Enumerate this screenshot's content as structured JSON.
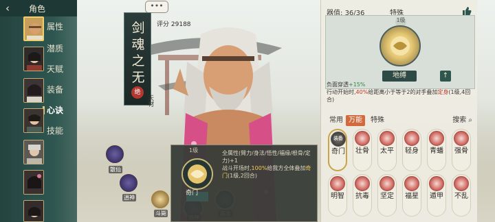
{
  "header": {
    "back_icon": "back-arrow-icon",
    "title": "角色"
  },
  "sidebar": {
    "menu": [
      {
        "label": "属性",
        "active": false
      },
      {
        "label": "潜质",
        "active": false
      },
      {
        "label": "天赋",
        "active": false
      },
      {
        "label": "装备",
        "active": false
      },
      {
        "label": "心诀",
        "active": true
      },
      {
        "label": "技能",
        "active": false
      }
    ],
    "avatars": [
      "avatar-1",
      "avatar-2",
      "avatar-3",
      "avatar-4",
      "avatar-5",
      "avatar-6",
      "avatar-7",
      "avatar-8"
    ]
  },
  "character": {
    "name": "剑魂之无",
    "name_badge": "绝",
    "talent": "天材",
    "score_label": "评分",
    "score_value": "29188",
    "chat_label": "•••"
  },
  "left_orbs": [
    {
      "label": "散仙"
    },
    {
      "label": "逍神"
    },
    {
      "label": "斗毙"
    },
    {
      "label": "游神"
    },
    {
      "label": "追击"
    }
  ],
  "popup": {
    "top_label": "1级",
    "name": "奇门",
    "text_1": "全属性(臂力/身法/悟性/福缘/根骨/定力)+1",
    "text_2_prefix": "战斗开场时,",
    "text_2_highlight": "100%",
    "text_2_mid": "给我方全体叠加",
    "text_2_buff": "奇门",
    "text_2_suffix": "(1级,2回合)"
  },
  "panel": {
    "weapon_label": "器值:",
    "weapon_value": "36/36",
    "special_label": "特殊",
    "like_icon": "thumbs-up-icon",
    "main_skill_small": "1级",
    "main_skill_name": "地缚",
    "arrow_icon": "up-arrow-icon",
    "effect_1_prefix": "负面穿透",
    "effect_1_value": "+15%",
    "effect_2_prefix": "行动开始时,",
    "effect_2_pct": "40%",
    "effect_2_mid": "给距离小于等于2的对手叠加",
    "effect_2_buff": "定身",
    "effect_2_suffix": "(1级,4回合)"
  },
  "tabs": [
    {
      "label": "常用",
      "active": false
    },
    {
      "label": "万能",
      "active": true
    },
    {
      "label": "特殊",
      "active": false
    }
  ],
  "search": {
    "label": "搜索",
    "icon": "search-icon"
  },
  "skills": [
    {
      "label": "奇门",
      "selected": true,
      "dark": true,
      "tag": "装备"
    },
    {
      "label": "壮骨",
      "selected": false,
      "dark": false
    },
    {
      "label": "太平",
      "selected": false,
      "dark": false
    },
    {
      "label": "轻身",
      "selected": false,
      "dark": false
    },
    {
      "label": "青蟠",
      "selected": false,
      "dark": false
    },
    {
      "label": "强骨",
      "selected": false,
      "dark": false
    },
    {
      "label": "明智",
      "selected": false,
      "dark": false
    },
    {
      "label": "抗毒",
      "selected": false,
      "dark": false
    },
    {
      "label": "坚定",
      "selected": false,
      "dark": false
    },
    {
      "label": "福星",
      "selected": false,
      "dark": false
    },
    {
      "label": "遁甲",
      "selected": false,
      "dark": false
    },
    {
      "label": "不乱",
      "selected": false,
      "dark": false
    }
  ]
}
